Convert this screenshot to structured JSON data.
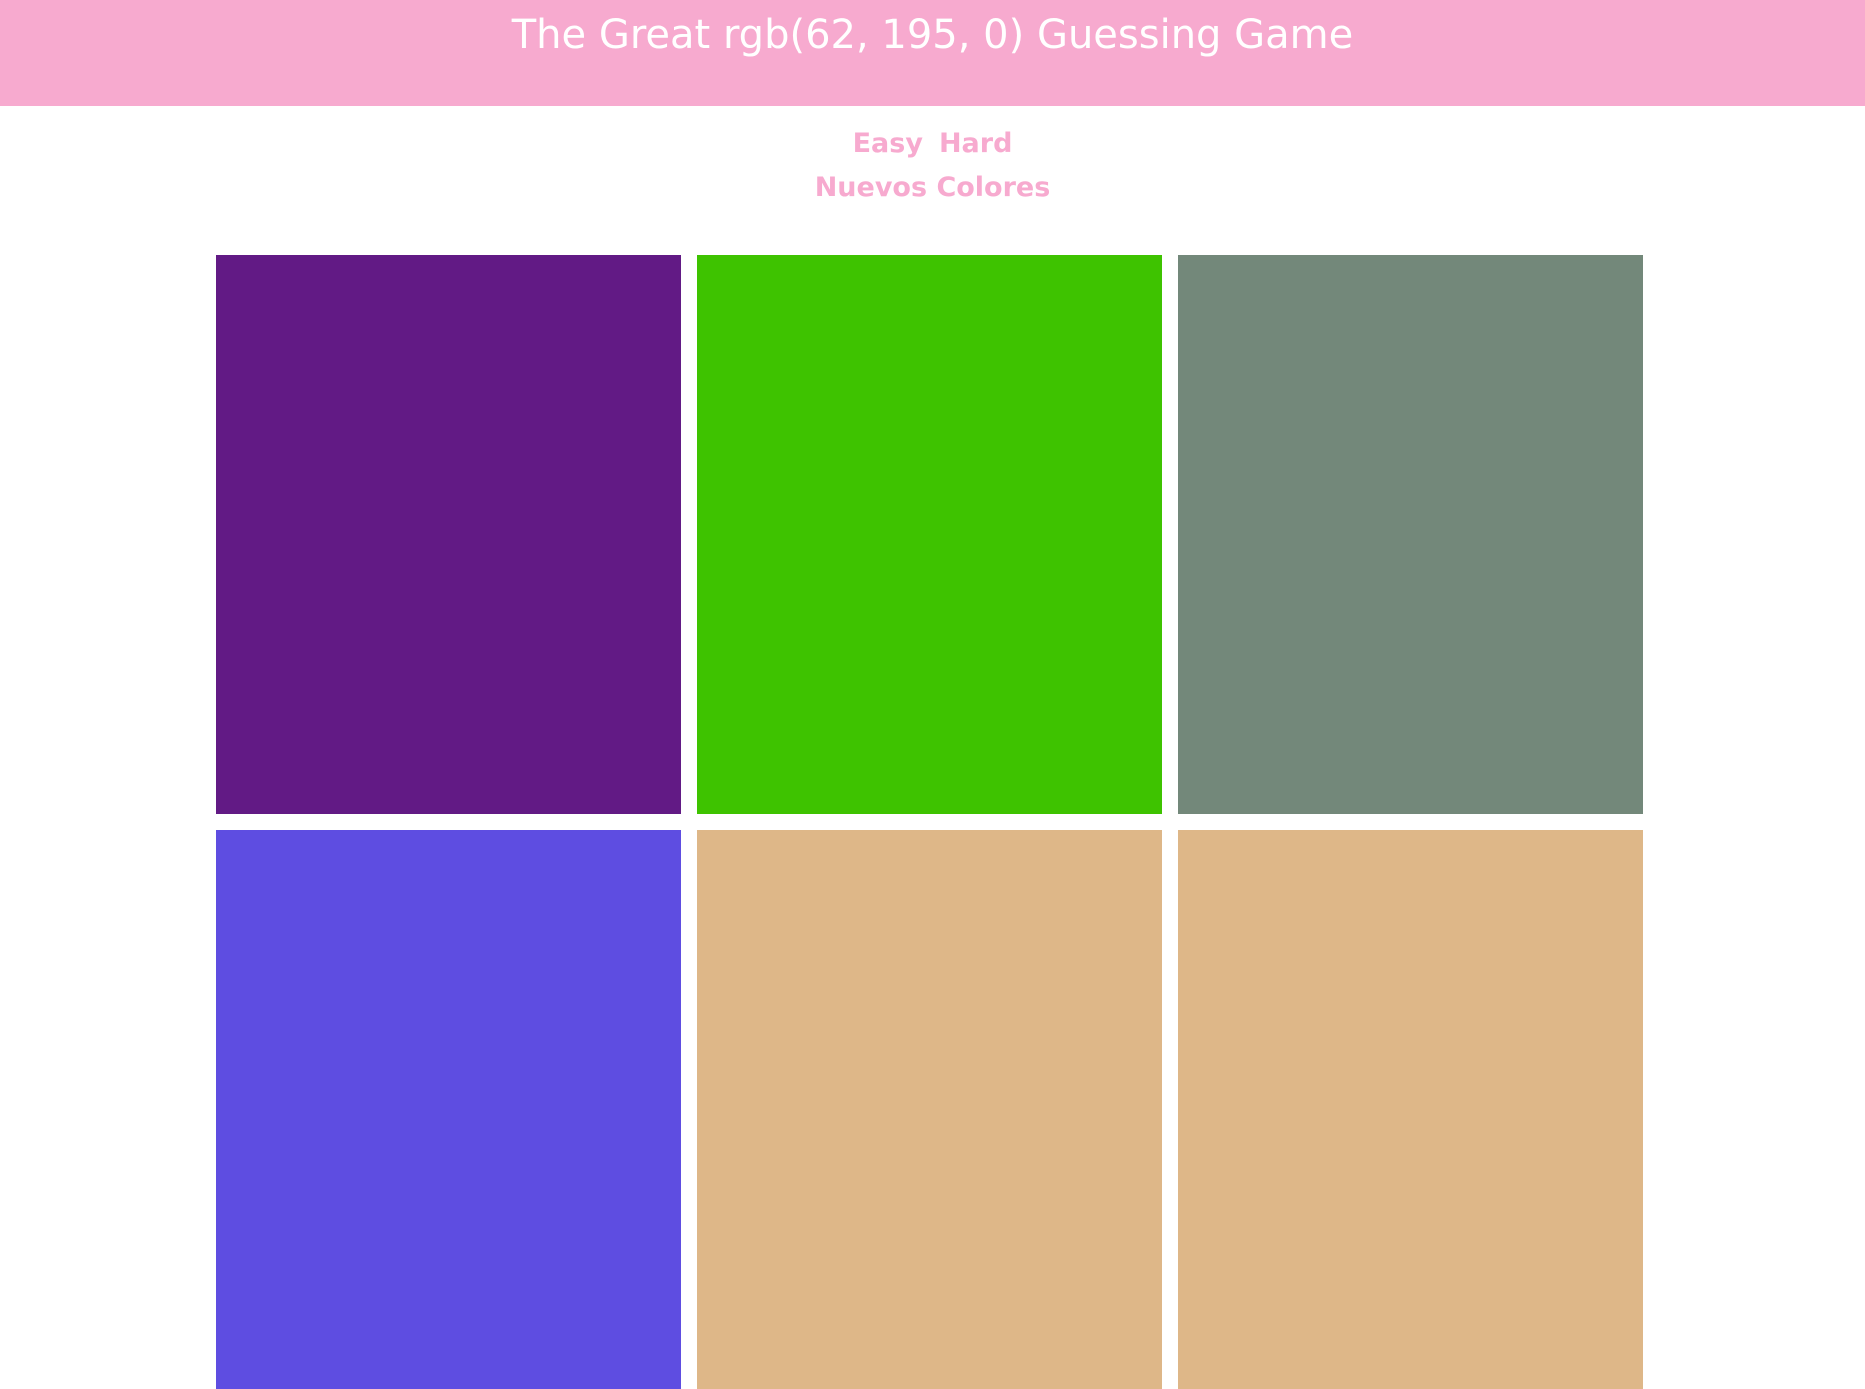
{
  "header": {
    "title": "The Great rgb(62, 195, 0) Guessing Game",
    "background_color": "#f7aacf"
  },
  "controls": {
    "easy_label": "Easy",
    "hard_label": "Hard",
    "new_colors_label": "Nuevos Colores",
    "accent_color": "#f7aacf"
  },
  "squares": [
    {
      "color": "#621a85"
    },
    {
      "color": "#3ec300"
    },
    {
      "color": "#73887a"
    },
    {
      "color": "#5e4de1"
    },
    {
      "color": "#deb788"
    },
    {
      "color": "#deb788"
    }
  ]
}
